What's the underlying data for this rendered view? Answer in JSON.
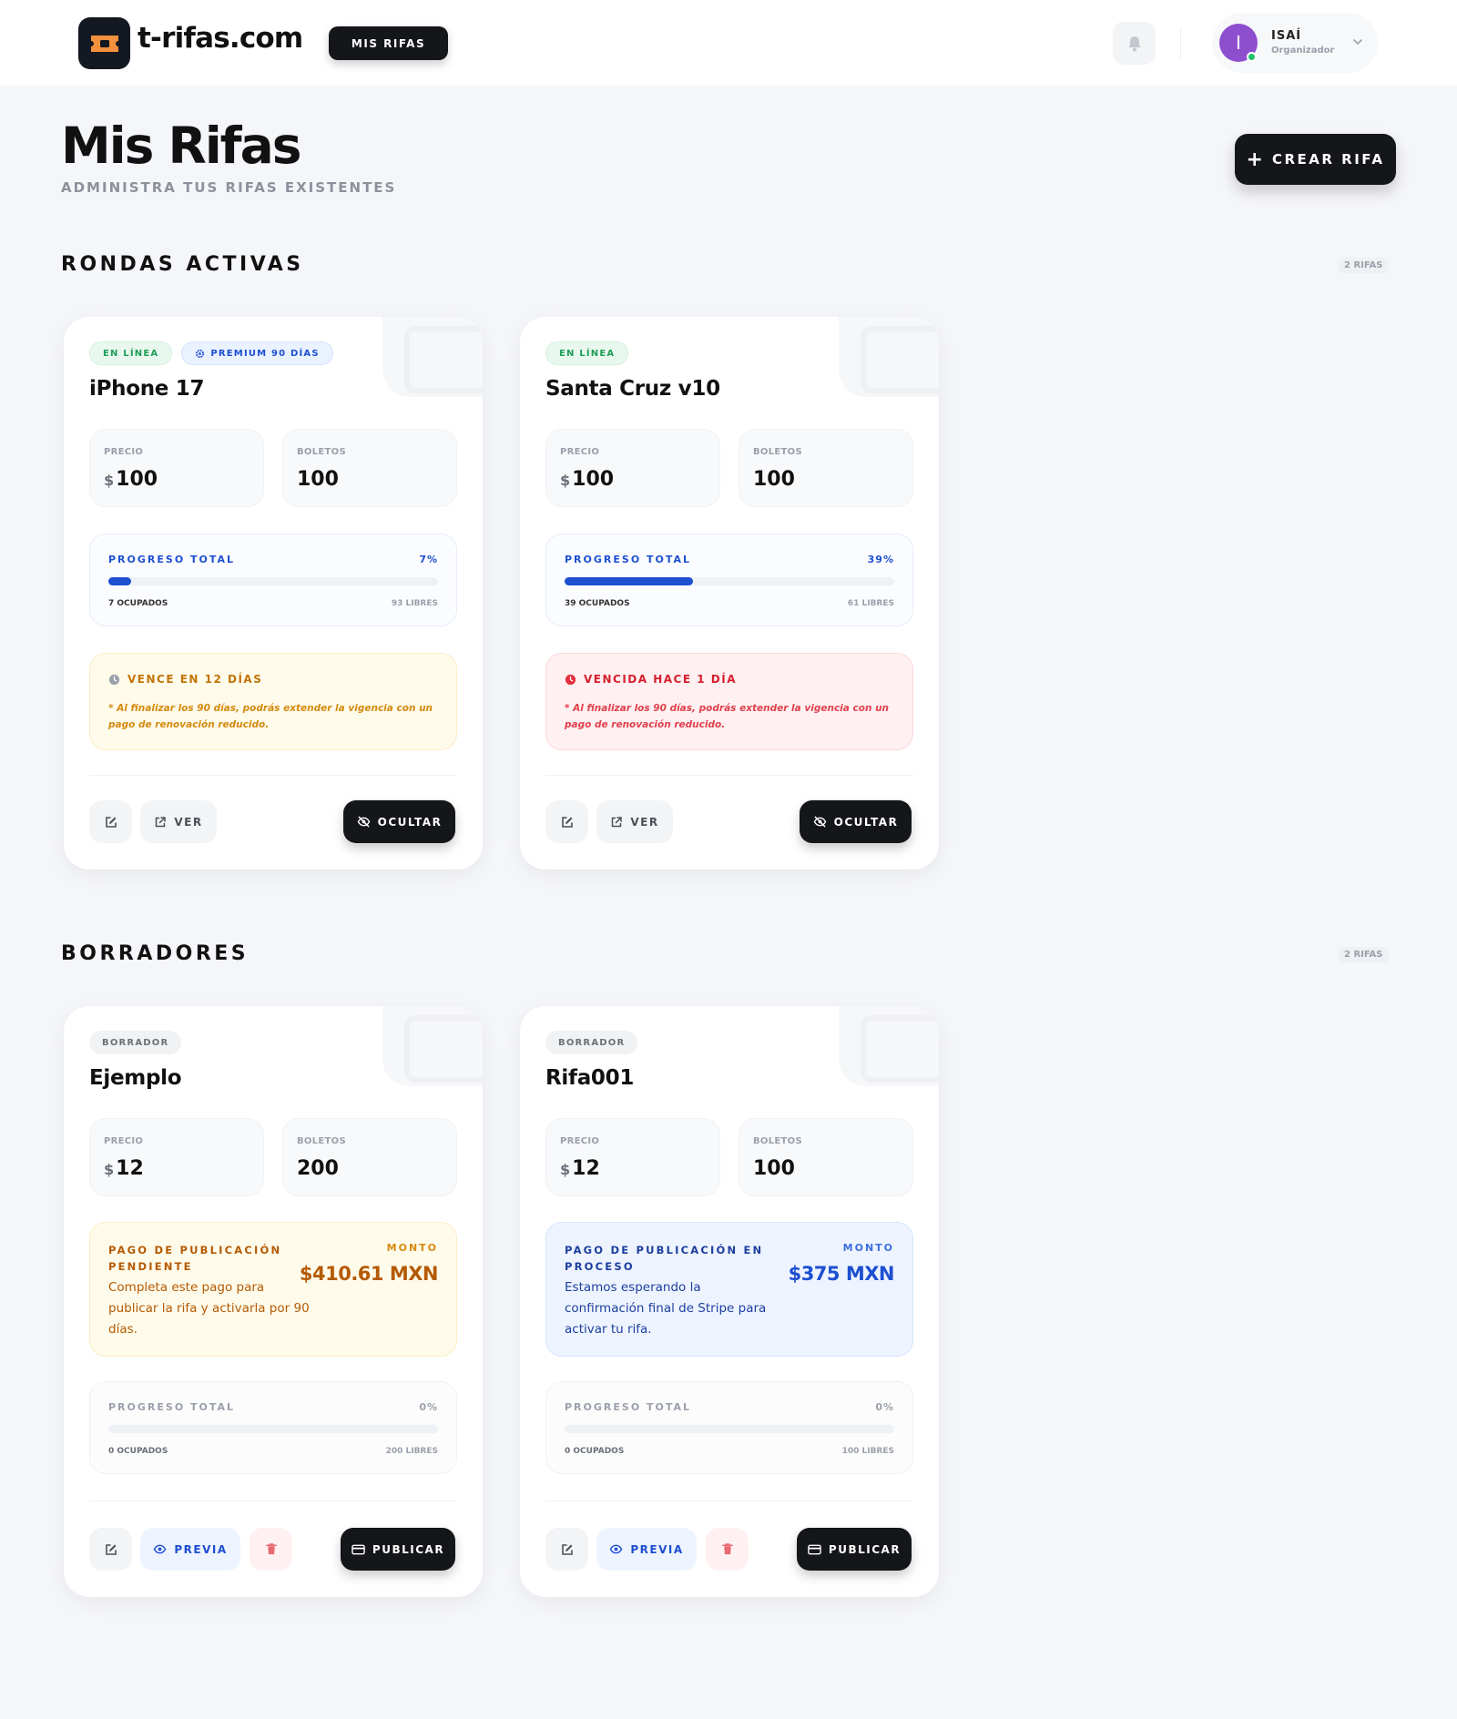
{
  "header": {
    "brand": "t-rifas.com",
    "nav_label": "MIS RIFAS",
    "user_initial": "I",
    "user_name": "ISAÍ",
    "user_role": "Organizador"
  },
  "page": {
    "title": "Mis Rifas",
    "subtitle": "ADMINISTRA TUS RIFAS EXISTENTES",
    "create_label": "CREAR RIFA",
    "create_icon": "+"
  },
  "sections": {
    "active": {
      "title": "RONDAS ACTIVAS",
      "count": "2 RIFAS",
      "cards": [
        {
          "badges": [
            "EN LÍNEA",
            "PREMIUM 90 DÍAS"
          ],
          "title": "iPhone 17",
          "price_label": "PRECIO",
          "price_currency": "$",
          "price": "100",
          "tickets_label": "BOLETOS",
          "tickets": "100",
          "progress_label": "PROGRESO TOTAL",
          "progress_pct": "7%",
          "progress_value": 7,
          "occupied": "7 OCUPADOS",
          "free": "93 LIBRES",
          "alert_title": "VENCE EN 12 DÍAS",
          "alert_note": "* Al finalizar los 90 días, podrás extender la vigencia con un pago de renovación reducido.",
          "view_label": "VER",
          "hide_label": "OCULTAR"
        },
        {
          "badges": [
            "EN LÍNEA"
          ],
          "title": "Santa Cruz v10",
          "price_label": "PRECIO",
          "price_currency": "$",
          "price": "100",
          "tickets_label": "BOLETOS",
          "tickets": "100",
          "progress_label": "PROGRESO TOTAL",
          "progress_pct": "39%",
          "progress_value": 39,
          "occupied": "39 OCUPADOS",
          "free": "61 LIBRES",
          "alert_title": "VENCIDA HACE 1 DÍA",
          "alert_note": "* Al finalizar los 90 días, podrás extender la vigencia con un pago de renovación reducido.",
          "view_label": "VER",
          "hide_label": "OCULTAR"
        }
      ]
    },
    "drafts": {
      "title": "BORRADORES",
      "count": "2 RIFAS",
      "cards": [
        {
          "badge": "BORRADOR",
          "title": "Ejemplo",
          "price_label": "PRECIO",
          "price_currency": "$",
          "price": "12",
          "tickets_label": "BOLETOS",
          "tickets": "200",
          "pay_title": "PAGO DE PUBLICACIÓN PENDIENTE",
          "pay_desc": "Completa este pago para publicar la rifa y activarla por 90 días.",
          "pay_label": "MONTO",
          "pay_amount": "$410.61 MXN",
          "progress_label": "PROGRESO TOTAL",
          "progress_pct": "0%",
          "progress_value": 0,
          "occupied": "0 OCUPADOS",
          "free": "200 LIBRES",
          "preview_label": "PREVIA",
          "publish_label": "PUBLICAR"
        },
        {
          "badge": "BORRADOR",
          "title": "Rifa001",
          "price_label": "PRECIO",
          "price_currency": "$",
          "price": "12",
          "tickets_label": "BOLETOS",
          "tickets": "100",
          "pay_title": "PAGO DE PUBLICACIÓN EN PROCESO",
          "pay_desc": "Estamos esperando la confirmación final de Stripe para activar tu rifa.",
          "pay_label": "MONTO",
          "pay_amount": "$375 MXN",
          "progress_label": "PROGRESO TOTAL",
          "progress_pct": "0%",
          "progress_value": 0,
          "occupied": "0 OCUPADOS",
          "free": "100 LIBRES",
          "preview_label": "PREVIA",
          "publish_label": "PUBLICAR"
        }
      ]
    }
  },
  "colors": {
    "accent": "#1d4fd1",
    "dark": "#14161a",
    "online_green": "#1f9d57",
    "warning": "#c27407",
    "danger": "#d71f2d",
    "avatar": "#8e4fcf"
  },
  "icons": {
    "logo": "ticket-icon",
    "bell": "bell-icon",
    "chevron": "chevron-down-icon",
    "edit": "edit-icon",
    "external": "external-link-icon",
    "hide": "eye-off-icon",
    "eye": "eye-icon",
    "trash": "trash-icon",
    "card": "credit-card-icon",
    "clock": "clock-icon",
    "alert": "alert-circle-icon",
    "gear": "gear-icon"
  }
}
